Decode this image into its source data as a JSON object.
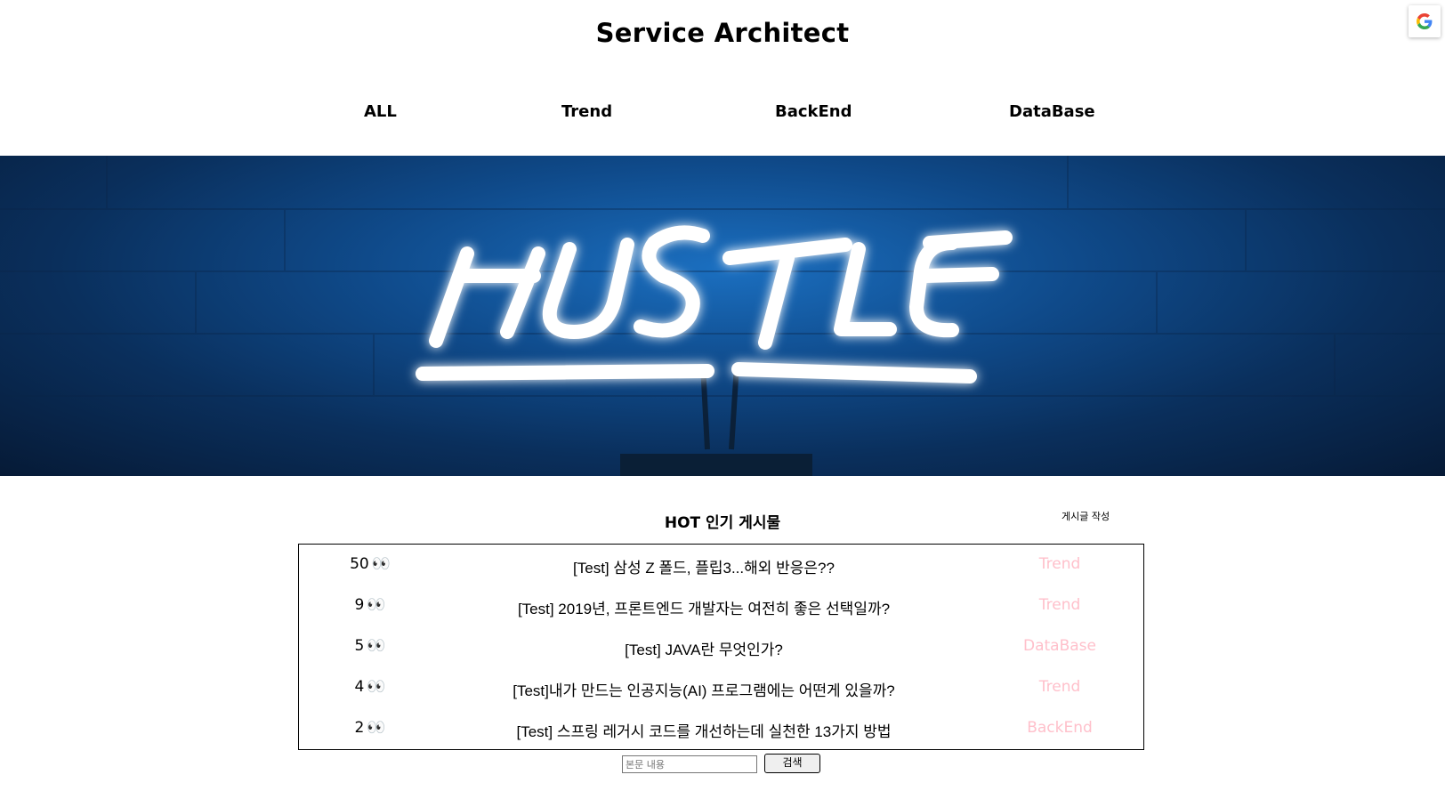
{
  "header": {
    "title": "Service Architect",
    "google_badge_icon": "google-g-icon"
  },
  "nav": {
    "items": [
      {
        "label": "ALL"
      },
      {
        "label": "Trend"
      },
      {
        "label": "BackEnd"
      },
      {
        "label": "DataBase"
      }
    ]
  },
  "hero": {
    "neon_text": "HUSTLE",
    "neon_color": "#ffffff",
    "background_color": "#0f4a8a"
  },
  "hot": {
    "title": "HOT 인기 게시물",
    "write_label": "게시글 작성",
    "category_color": "#ffc0cb",
    "eyes_icon": "👀",
    "posts": [
      {
        "views": "50",
        "title": "[Test] 삼성 Z 폴드, 플립3...해외 반응은??",
        "category": "Trend"
      },
      {
        "views": "9",
        "title": "[Test] 2019년, 프론트엔드 개발자는 여전히 좋은 선택일까?",
        "category": "Trend"
      },
      {
        "views": "5",
        "title": "[Test] JAVA란 무엇인가?",
        "category": "DataBase"
      },
      {
        "views": "4",
        "title": "[Test]내가 만드는 인공지능(AI) 프로그램에는 어떤게 있을까?",
        "category": "Trend"
      },
      {
        "views": "2",
        "title": "[Test] 스프링 레거시 코드를 개선하는데 실천한 13가지 방법",
        "category": "BackEnd"
      }
    ]
  },
  "search": {
    "placeholder": "본문 내용",
    "button_label": "검색"
  }
}
